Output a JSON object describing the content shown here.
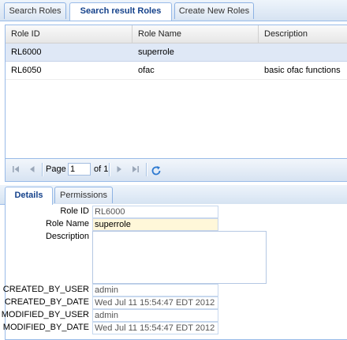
{
  "top_tabs": [
    {
      "label": "Search Roles",
      "active": false
    },
    {
      "label": "Search result Roles",
      "active": true
    },
    {
      "label": "Create New Roles",
      "active": false
    }
  ],
  "grid": {
    "columns": [
      "Role ID",
      "Role Name",
      "Description"
    ],
    "rows": [
      {
        "role_id": "RL6000",
        "role_name": "superrole",
        "description": "",
        "selected": true
      },
      {
        "role_id": "RL6050",
        "role_name": "ofac",
        "description": "basic ofac functions",
        "selected": false
      }
    ]
  },
  "pager": {
    "page_label": "Page",
    "page_value": "1",
    "of_label": "of 1",
    "icons": [
      "first-page-icon",
      "prev-page-icon",
      "next-page-icon",
      "last-page-icon",
      "refresh-icon"
    ]
  },
  "bottom_tabs": [
    {
      "label": "Details",
      "active": true
    },
    {
      "label": "Permissions",
      "active": false
    }
  ],
  "form": {
    "role_id_label": "Role ID",
    "role_id_value": "RL6000",
    "role_name_label": "Role Name",
    "role_name_value": "superrole",
    "description_label": "Description",
    "description_value": "",
    "created_by_user_label": "CREATED_BY_USER",
    "created_by_user_value": "admin",
    "created_by_date_label": "CREATED_BY_DATE",
    "created_by_date_value": "Wed Jul 11 15:54:47 EDT 2012",
    "modified_by_user_label": "MODIFIED_BY_USER",
    "modified_by_user_value": "admin",
    "modified_by_date_label": "MODIFIED_BY_DATE",
    "modified_by_date_value": "Wed Jul 11 15:54:47 EDT 2012"
  },
  "colors": {
    "accent": "#15428b",
    "border": "#99bbe8",
    "selected_row": "#dfe8f6",
    "focused_field": "#fff7d9"
  }
}
